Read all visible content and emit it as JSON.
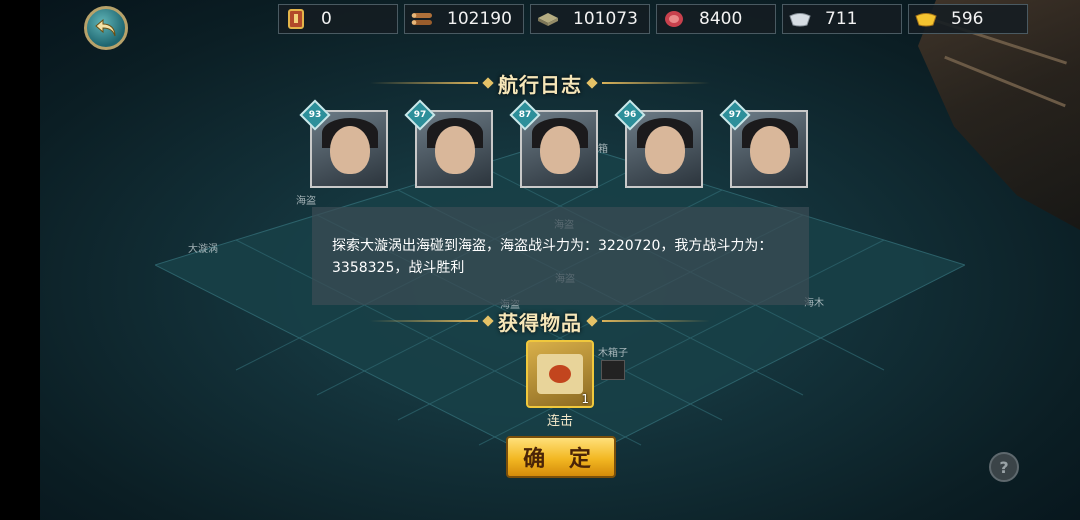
{
  "resources": [
    {
      "icon": "order-token-icon",
      "value": "0"
    },
    {
      "icon": "wood-logs-icon",
      "value": "102190"
    },
    {
      "icon": "stone-bricks-icon",
      "value": "101073"
    },
    {
      "icon": "meat-icon",
      "value": "8400"
    },
    {
      "icon": "silver-ingot-icon",
      "value": "711"
    },
    {
      "icon": "gold-ingot-icon",
      "value": "596"
    }
  ],
  "panel": {
    "title": "航行日志",
    "heroes": [
      {
        "level": "93"
      },
      {
        "level": "97"
      },
      {
        "level": "87"
      },
      {
        "level": "96"
      },
      {
        "level": "97"
      }
    ],
    "message": "探索大漩涡出海碰到海盗，海盗战斗力为：3220720，我方战斗力为：3358325，战斗胜利",
    "rewards_title": "获得物品",
    "reward": {
      "name": "连击",
      "count": "1"
    },
    "confirm_label": "确 定"
  },
  "map_labels": [
    "大漩涡",
    "海盗",
    "宝箱",
    "海盗",
    "海盗",
    "木箱子",
    "海盗",
    "海木"
  ],
  "help_label": "?",
  "colors": {
    "accent_gold": "#e5c267",
    "button_gold": "#f2b722",
    "hero_level_badge": "#2d8f9a"
  }
}
